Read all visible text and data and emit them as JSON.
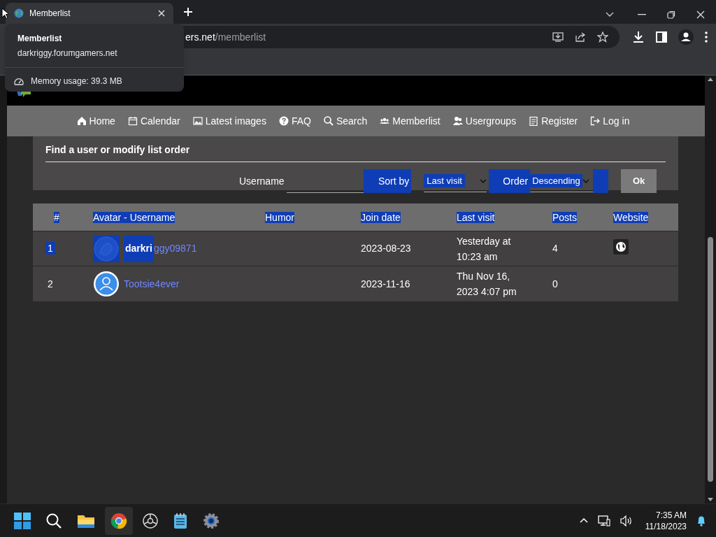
{
  "browser": {
    "tab": {
      "title": "Memberlist",
      "selected": true
    },
    "address": {
      "host_part": "ers.net",
      "path": "/memberlist"
    },
    "tooltip": {
      "title": "Memberlist",
      "host": "darkriggy.forumgamers.net",
      "memory": "Memory usage: 39.3 MB"
    }
  },
  "nav": [
    {
      "kind": "home",
      "label": "Home"
    },
    {
      "kind": "calendar",
      "label": "Calendar"
    },
    {
      "kind": "images",
      "label": "Latest images"
    },
    {
      "kind": "faq",
      "label": "FAQ"
    },
    {
      "kind": "search",
      "label": "Search"
    },
    {
      "kind": "members",
      "label": "Memberlist"
    },
    {
      "kind": "groups",
      "label": "Usergroups"
    },
    {
      "kind": "register",
      "label": "Register"
    },
    {
      "kind": "login",
      "label": "Log in"
    }
  ],
  "search_panel": {
    "title": "Find a user or modify list order",
    "username_label": "Username",
    "sort_label": "Sort by",
    "sort_value": "Last visit",
    "order_label": "Order",
    "order_value": "Descending",
    "ok": "Ok"
  },
  "table": {
    "columns": [
      {
        "label": "#",
        "highlighted": true
      },
      {
        "label": "Avatar - Username",
        "highlighted": true
      },
      {
        "label": "Humor",
        "highlighted": true
      },
      {
        "label": "Join date",
        "highlighted": true
      },
      {
        "label": "Last visit",
        "highlighted": true
      },
      {
        "label": "Posts",
        "highlighted": true
      },
      {
        "label": "Website",
        "highlighted": true
      }
    ],
    "rows": [
      {
        "number": "1",
        "number_highlighted": true,
        "kind": "custom",
        "name_selected": "darkri",
        "name_rest": "ggy09871",
        "join_date": "2023-08-23",
        "last_visit": "Yesterday at 10:23 am",
        "posts": "4",
        "website": true
      },
      {
        "number": "2",
        "number_highlighted": false,
        "kind": "default",
        "name_rest": "Tootsie4ever",
        "join_date": "2023-11-16",
        "last_visit": "Thu Nov 16, 2023 4:07 pm",
        "posts": "0",
        "website": false
      }
    ]
  },
  "taskbar": {
    "time": "7:35 AM",
    "date": "11/18/2023"
  }
}
